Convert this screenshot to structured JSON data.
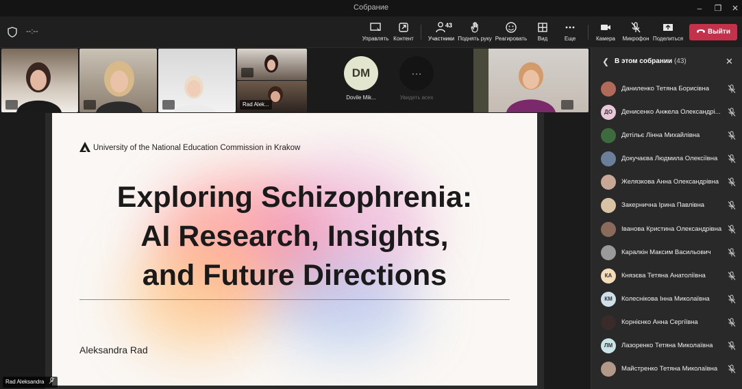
{
  "window": {
    "title": "Собрание"
  },
  "meeting": {
    "timer": "--:--"
  },
  "toolbar": {
    "manage": "Управлять",
    "content": "Контент",
    "participants": "Участники",
    "participants_count": "43",
    "raise_hand": "Поднять руку",
    "react": "Реагировать",
    "view": "Вид",
    "more": "Еще",
    "camera": "Камера",
    "mic": "Микрофон",
    "share": "Поделиться",
    "leave": "Выйти"
  },
  "stage": {
    "tile_name_rad": "Rad Alek...",
    "dm_initials": "DM",
    "dm_name": "Dovile Mik...",
    "see_all": "Увидеть всех",
    "self_name": "Rad Aleksandra"
  },
  "slide": {
    "university": "University of the National Education Commission in Krakow",
    "title_line1": "Exploring Schizophrenia:",
    "title_line2": "AI Research, Insights,",
    "title_line3": "and Future Directions",
    "author": "Aleksandra Rad"
  },
  "panel": {
    "title": "В этом собрании",
    "count": "(43)",
    "participants": [
      {
        "name": "Даниленко Тетяна Борисівна",
        "initials": "",
        "color": "#b06a5a"
      },
      {
        "name": "Денисенко Анжела Олександрі...",
        "initials": "ДО",
        "color": "#e7c7d8"
      },
      {
        "name": "Детільє Лінна Михайлівна",
        "initials": "",
        "color": "#3e6b3e"
      },
      {
        "name": "Докучаєва Людмила Олексіївна",
        "initials": "",
        "color": "#6b7f9a"
      },
      {
        "name": "Желязкова Анна Олександрівна",
        "initials": "",
        "color": "#c8a796"
      },
      {
        "name": "Закернична Ірина Павлівна",
        "initials": "",
        "color": "#d9c3a5"
      },
      {
        "name": "Іванова Кристина Олександрівна",
        "initials": "",
        "color": "#8a6a5a"
      },
      {
        "name": "Каралкін Максим Васильович",
        "initials": "",
        "color": "#9a9a9a"
      },
      {
        "name": "Князєва Тетяна Анатоліївна",
        "initials": "КА",
        "color": "#f3dcb8"
      },
      {
        "name": "Колеснікова Інна Миколаївна",
        "initials": "КМ",
        "color": "#cfe0ea"
      },
      {
        "name": "Корнієнко Анна Сергіївна",
        "initials": "",
        "color": "#3a2a2a"
      },
      {
        "name": "Лазоренко Тетяна Миколаївна",
        "initials": "ЛМ",
        "color": "#c9e3e6"
      },
      {
        "name": "Майстренко Тетяна Миколаївна",
        "initials": "",
        "color": "#b39a88"
      }
    ]
  }
}
